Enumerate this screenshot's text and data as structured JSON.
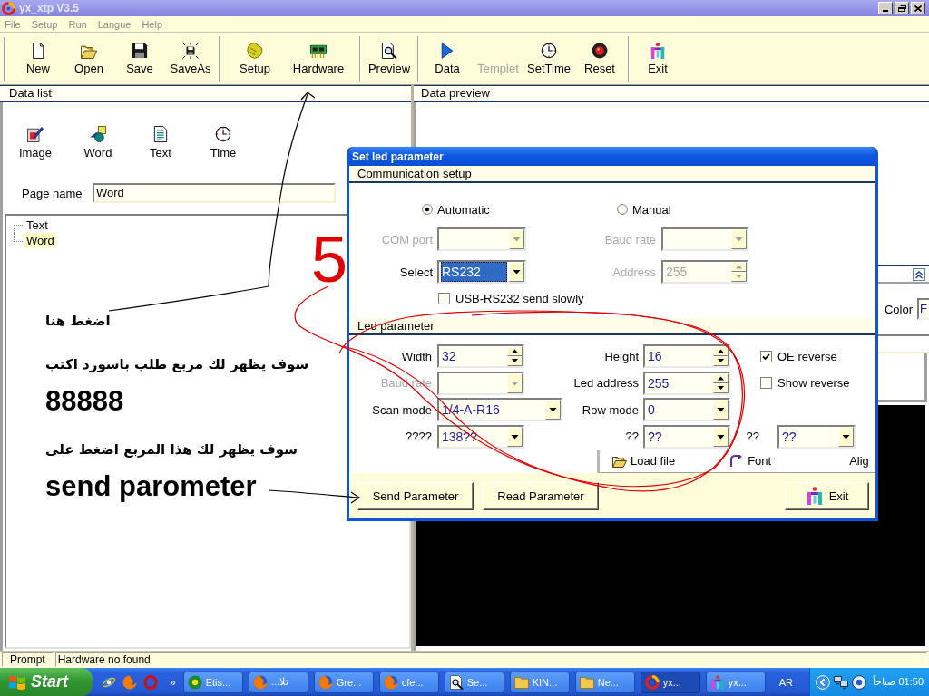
{
  "window": {
    "title": "yx_xtp V3.5"
  },
  "menu": [
    {
      "label": "File",
      "disabled": true
    },
    {
      "label": "Setup",
      "disabled": true
    },
    {
      "label": "Run",
      "disabled": true
    },
    {
      "label": "Langue",
      "disabled": true
    },
    {
      "label": "Help",
      "disabled": true
    }
  ],
  "toolbar": [
    [
      {
        "label": "New",
        "disabled": false
      },
      {
        "label": "Open",
        "disabled": false
      },
      {
        "label": "Save",
        "disabled": false
      },
      {
        "label": "SaveAs",
        "disabled": false
      }
    ],
    [
      {
        "label": "Setup",
        "disabled": false
      },
      {
        "label": "Hardware",
        "disabled": false
      }
    ],
    [
      {
        "label": "Preview",
        "disabled": false
      }
    ],
    [
      {
        "label": "Data",
        "disabled": false
      },
      {
        "label": "Templet",
        "disabled": true
      },
      {
        "label": "SetTime",
        "disabled": false
      },
      {
        "label": "Reset",
        "disabled": false
      }
    ],
    [
      {
        "label": "Exit",
        "disabled": false
      }
    ]
  ],
  "data_list": {
    "header": "Data list",
    "inserts": [
      "Image",
      "Word",
      "Text",
      "Time"
    ],
    "page_name": {
      "label": "Page name",
      "value": "Word"
    },
    "tree": [
      {
        "label": "Text",
        "selected": false
      },
      {
        "label": "Word",
        "selected": true
      }
    ]
  },
  "notes": [
    {
      "text": "اضغط هنا",
      "kind": "note"
    },
    {
      "text": "سوف يظهر لك مربع طلب باسورد اكتب",
      "kind": "note"
    },
    {
      "text": "88888",
      "kind": "emphasis"
    },
    {
      "text": "سوف يظهر لك هذا المربع  اضغط على",
      "kind": "note"
    },
    {
      "text": "send parometer",
      "kind": "emphasis"
    }
  ],
  "scribble": "5",
  "data_preview": {
    "header": "Data preview",
    "color": {
      "label": "Color",
      "value": "F"
    }
  },
  "dialog": {
    "title": "Set led parameter",
    "communication": {
      "header": "Communication setup",
      "modes": [
        {
          "label": "Automatic",
          "selected": true
        },
        {
          "label": "Manual",
          "selected": false
        }
      ],
      "fields": [
        {
          "label": "COM port",
          "kind": "combo",
          "disabled": true,
          "focused": false
        },
        {
          "label": "Baud rate",
          "kind": "combo",
          "disabled": true,
          "focused": false
        },
        {
          "label": "Select",
          "kind": "combo",
          "value": "RS232",
          "disabled": false,
          "focused": true
        },
        {
          "label": "Address",
          "kind": "spin",
          "value": "255",
          "disabled": true,
          "focused": false
        }
      ],
      "option": {
        "label": "USB-RS232 send slowly",
        "checked": false
      }
    },
    "led": {
      "header": "Led parameter",
      "fields": [
        {
          "label": "Width",
          "kind": "spin",
          "value": "32",
          "disabled": false
        },
        {
          "label": "Height",
          "kind": "spin",
          "value": "16",
          "disabled": false
        },
        {
          "label": "Baud rate",
          "kind": "combo",
          "disabled": true
        },
        {
          "label": "Led address",
          "kind": "spin",
          "value": "255",
          "disabled": false
        },
        {
          "label": "Scan mode",
          "kind": "combo",
          "value": "1/4-A-R16",
          "disabled": false
        },
        {
          "label": "Row mode",
          "kind": "combo",
          "value": "0",
          "disabled": false
        },
        {
          "label": "????",
          "kind": "combo",
          "value": "138??",
          "disabled": false
        },
        {
          "label": "??",
          "kind": "combo",
          "value": "??",
          "disabled": false
        },
        {
          "label": "??",
          "kind": "combo",
          "value": "??",
          "disabled": false
        }
      ],
      "options": [
        {
          "label": "OE reverse",
          "checked": true
        },
        {
          "label": "Show reverse",
          "checked": false
        }
      ],
      "background_tools": [
        "Load file",
        "Font",
        "Alig"
      ]
    },
    "buttons": [
      "Send Parameter",
      "Read Parameter",
      "Exit"
    ]
  },
  "status_bar": {
    "label": "Prompt",
    "message": "Hardware no found."
  },
  "taskbar": {
    "start": "Start",
    "more": "»",
    "tasks": [
      {
        "label": "Etis...",
        "selected": false
      },
      {
        "label": "تلا...",
        "selected": false
      },
      {
        "label": "Gre...",
        "selected": false
      },
      {
        "label": "cfe...",
        "selected": false
      },
      {
        "label": "Se...",
        "selected": false
      },
      {
        "label": "KIN...",
        "selected": false
      },
      {
        "label": "Ne...",
        "selected": false
      },
      {
        "label": "yx...",
        "selected": true
      },
      {
        "label": "yx...",
        "selected": false
      }
    ],
    "language": "AR",
    "clock": "01:50 صباحاً"
  }
}
